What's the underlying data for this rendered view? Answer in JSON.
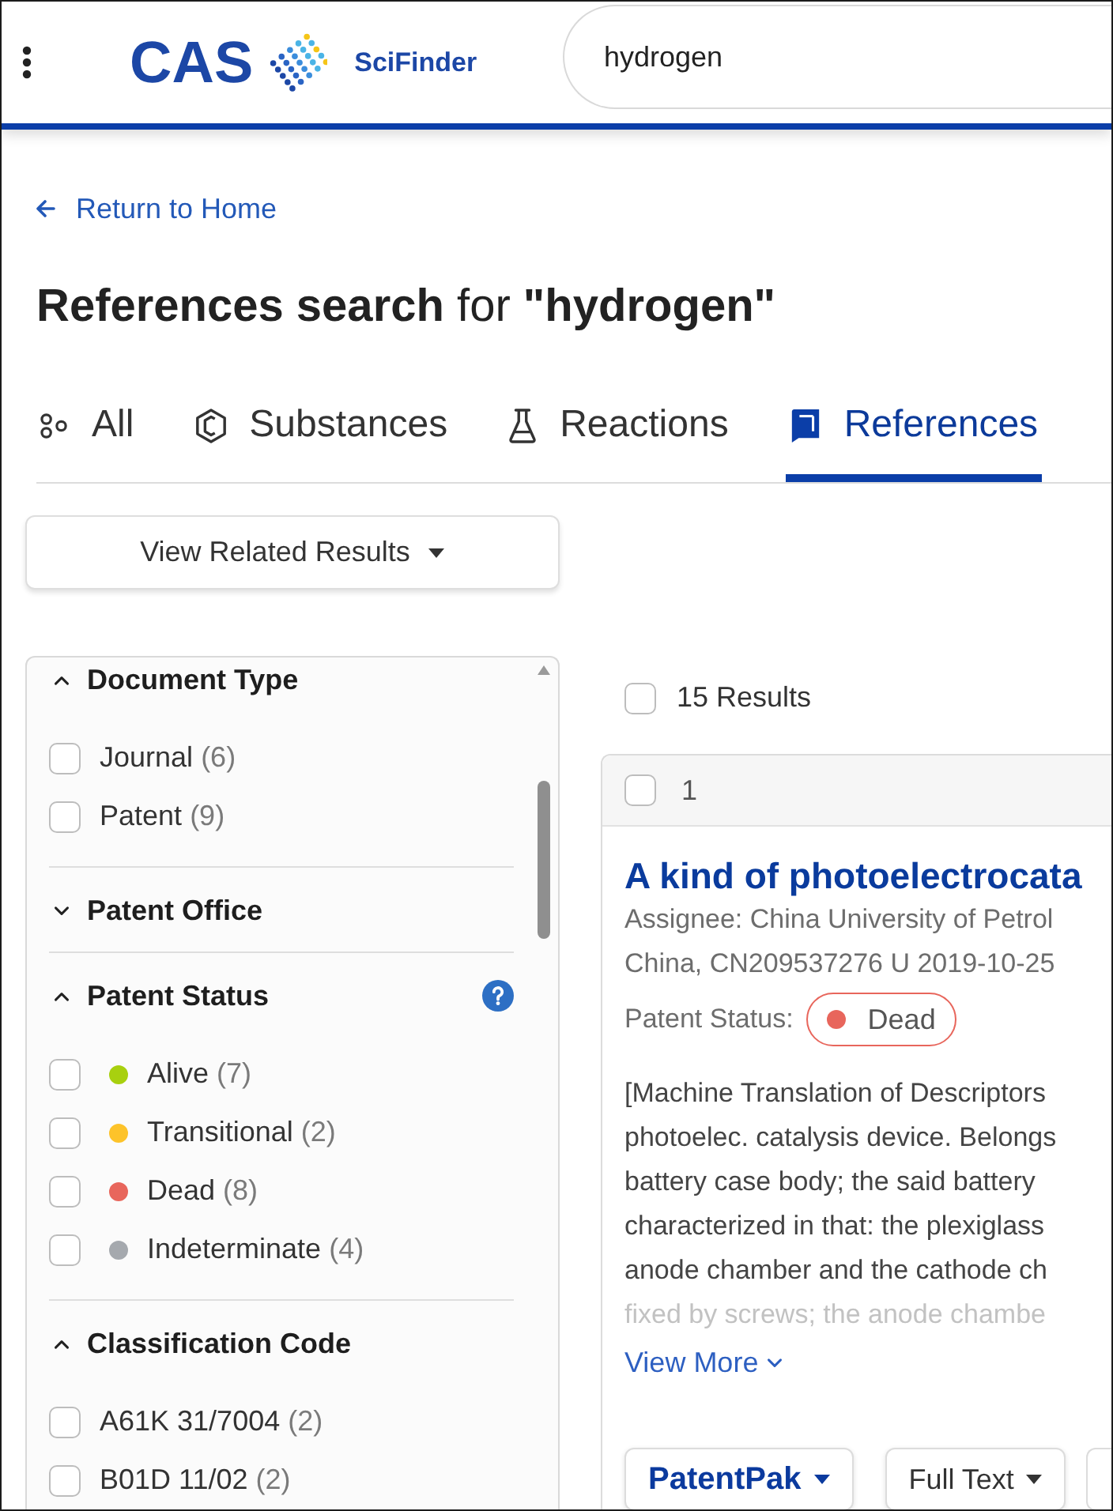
{
  "header": {
    "logo_text": "CAS",
    "product_name": "SciFinder",
    "search": {
      "value": "hydrogen"
    }
  },
  "back_link": {
    "label": "Return to Home"
  },
  "title": "**References search** for **\"hydrogen\"**",
  "tabs": [
    {
      "label": "All",
      "selected": false
    },
    {
      "label": "Substances",
      "selected": false
    },
    {
      "label": "Reactions",
      "selected": false
    },
    {
      "label": "References",
      "selected": true
    }
  ],
  "related_results": {
    "label": "View Related Results"
  },
  "filters": [
    {
      "title": "Document Type",
      "expanded": true,
      "options": [
        {
          "label": "Journal",
          "count": "(6)",
          "checked": false
        },
        {
          "label": "Patent",
          "count": "(9)",
          "checked": false
        }
      ]
    },
    {
      "title": "Patent Office",
      "expanded": false
    },
    {
      "title": "Patent Status",
      "expanded": true,
      "help": true,
      "options": [
        {
          "label": "Alive",
          "count": "(7)",
          "checked": false,
          "color": "#a8d00f"
        },
        {
          "label": "Transitional",
          "count": "(2)",
          "checked": false,
          "color": "#fdc32a"
        },
        {
          "label": "Dead",
          "count": "(8)",
          "checked": false,
          "color": "#e8665c"
        },
        {
          "label": "Indeterminate",
          "count": "(4)",
          "checked": false,
          "color": "#a5a9ae"
        }
      ]
    },
    {
      "title": "Classification Code",
      "expanded": true,
      "options": [
        {
          "label": "A61K 31/7004",
          "count": "(2)",
          "checked": false
        },
        {
          "label": "B01D 11/02",
          "count": "(2)",
          "checked": false
        }
      ]
    }
  ],
  "results": {
    "summary": "15 Results",
    "all_checked": false,
    "items": [
      {
        "number": "1",
        "checked": false,
        "title": "A kind of photoelectrocata",
        "details": [
          "Assignee: China University of Petrol",
          "China, CN209537276 U 2019-10-25"
        ],
        "status_label": "Patent Status:",
        "status": {
          "label": "Dead",
          "color": "#e8665c"
        },
        "abstract": [
          "[Machine Translation of Descriptors",
          "photoelec. catalysis device. Belongs",
          "battery case body; the said battery",
          "characterized in that: the plexiglass",
          "anode chamber and the cathode ch",
          "fixed by screws; the anode chambe"
        ],
        "view_more": "View More",
        "actions": [
          {
            "label": "PatentPak",
            "kind": "primary"
          },
          {
            "label": "Full Text",
            "kind": "secondary"
          }
        ]
      }
    ]
  }
}
